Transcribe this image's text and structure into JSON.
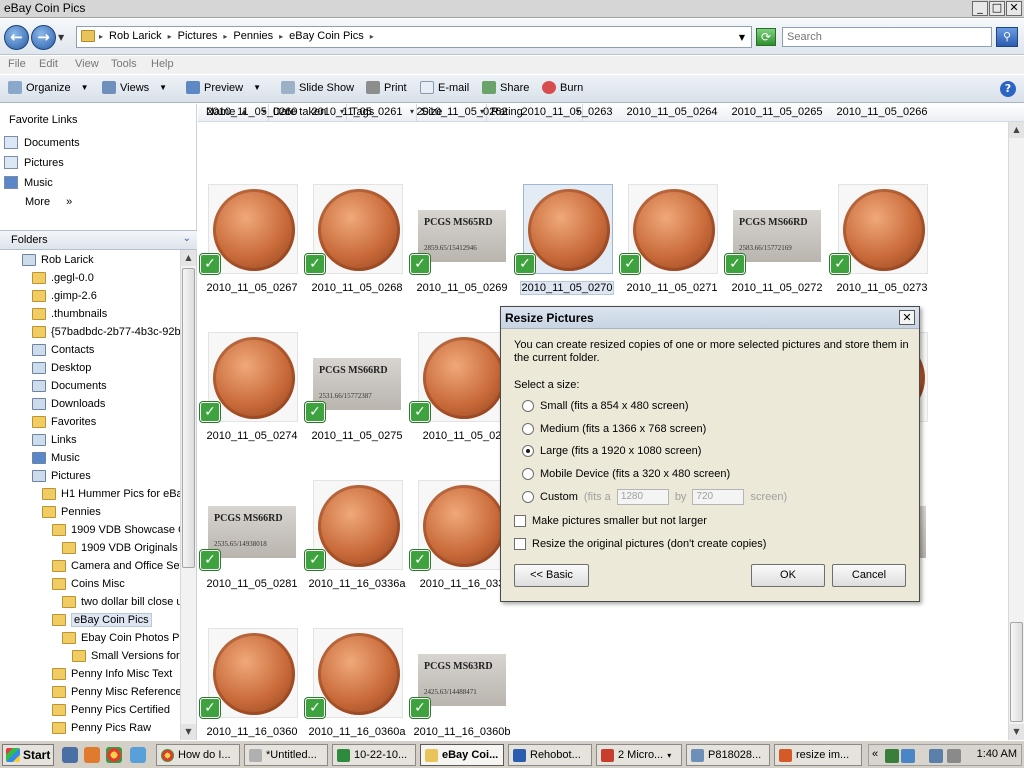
{
  "window": {
    "title": "eBay Coin Pics"
  },
  "address": {
    "crumbs": [
      "Rob Larick",
      "Pictures",
      "Pennies",
      "eBay Coin Pics"
    ],
    "search_placeholder": "Search"
  },
  "menu": {
    "items": [
      "File",
      "Edit",
      "View",
      "Tools",
      "Help"
    ]
  },
  "toolbar": {
    "organize": "Organize",
    "views": "Views",
    "preview": "Preview",
    "slideshow": "Slide Show",
    "print": "Print",
    "email": "E-mail",
    "share": "Share",
    "burn": "Burn"
  },
  "favorites": {
    "heading": "Favorite Links",
    "items": [
      "Documents",
      "Pictures",
      "Music"
    ],
    "more": "More",
    "more_arrow": "»"
  },
  "folders": {
    "heading": "Folders",
    "tree": [
      "Rob Larick",
      ".gegl-0.0",
      ".gimp-2.6",
      ".thumbnails",
      "{57badbdc-2b77-4b3c-92b",
      "Contacts",
      "Desktop",
      "Documents",
      "Downloads",
      "Favorites",
      "Links",
      "Music",
      "Pictures",
      "H1 Hummer Pics for eBay",
      "Pennies",
      "1909 VDB Showcase Co",
      "1909 VDB Originals fo",
      "Camera and Office Set",
      "Coins Misc",
      "two dollar bill close u",
      "eBay Coin Pics",
      "Ebay Coin Photos Pe",
      "Small Versions for u",
      "Penny Info Misc Text",
      "Penny Misc Reference",
      "Penny Pics Certified",
      "Penny Pics Raw"
    ]
  },
  "columns": [
    "Name",
    "Date taken",
    "Tags",
    "Size",
    "Rating"
  ],
  "files": {
    "row0": [
      "2010_11_05_0260",
      "2010_11_05_0261",
      "2010_11_05_0262",
      "2010_11_05_0263",
      "2010_11_05_0264",
      "2010_11_05_0265",
      "2010_11_05_0266"
    ],
    "row1": [
      "2010_11_05_0267",
      "2010_11_05_0268",
      "2010_11_05_0269",
      "2010_11_05_0270",
      "2010_11_05_0271",
      "2010_11_05_0272",
      "2010_11_05_0273"
    ],
    "row2": [
      "2010_11_05_0274",
      "2010_11_05_0275",
      "2010_11_05_02",
      "80"
    ],
    "row3": [
      "2010_11_05_0281",
      "2010_11_16_0336a",
      "2010_11_16_033",
      "40"
    ],
    "row4": [
      "2010_11_16_0360",
      "2010_11_16_0360a",
      "2010_11_16_0360b"
    ]
  },
  "slabs": {
    "s0269": {
      "grade": "PCGS MS65RD",
      "cert": "2859.65/15412946"
    },
    "s0272": {
      "grade": "PCGS MS66RD",
      "cert": "2583.66/15772169"
    },
    "s0275": {
      "grade": "PCGS MS66RD",
      "cert": "2531.66/15772387"
    },
    "s0281": {
      "grade": "PCGS MS66RD",
      "cert": "2535.65/14938018"
    },
    "s0360b": {
      "grade": "PCGS MS63RD",
      "cert": "2425.63/14488471"
    }
  },
  "dialog": {
    "title": "Resize Pictures",
    "description": "You can create resized copies of one or more selected pictures and store them in the current folder.",
    "select_label": "Select a size:",
    "options": [
      "Small (fits a 854 x 480 screen)",
      "Medium (fits a 1366 x 768 screen)",
      "Large (fits a 1920 x 1080 screen)",
      "Mobile Device (fits a 320 x 480 screen)"
    ],
    "custom_label": "Custom",
    "custom_fits": "(fits a",
    "custom_by": "by",
    "custom_screen": "screen)",
    "custom_width": "1280",
    "custom_height": "720",
    "selected_option": "Large (fits a 1920 x 1080 screen)",
    "check_smaller": "Make pictures smaller but not larger",
    "check_original": "Resize the original pictures (don't create copies)",
    "basic_button": "<< Basic",
    "ok_button": "OK",
    "cancel_button": "Cancel"
  },
  "taskbar": {
    "start": "Start",
    "tasks": [
      "How do I...",
      "*Untitled...",
      "10-22-10...",
      "eBay Coi...",
      "Rehobot...",
      "2 Micro...",
      "P818028...",
      "resize im..."
    ],
    "tray_arrow": "«",
    "clock": "1:40 AM"
  },
  "colors": {
    "copper": "#c96a3a",
    "check_green": "#3ea33e",
    "selection": "#dde6f1"
  }
}
